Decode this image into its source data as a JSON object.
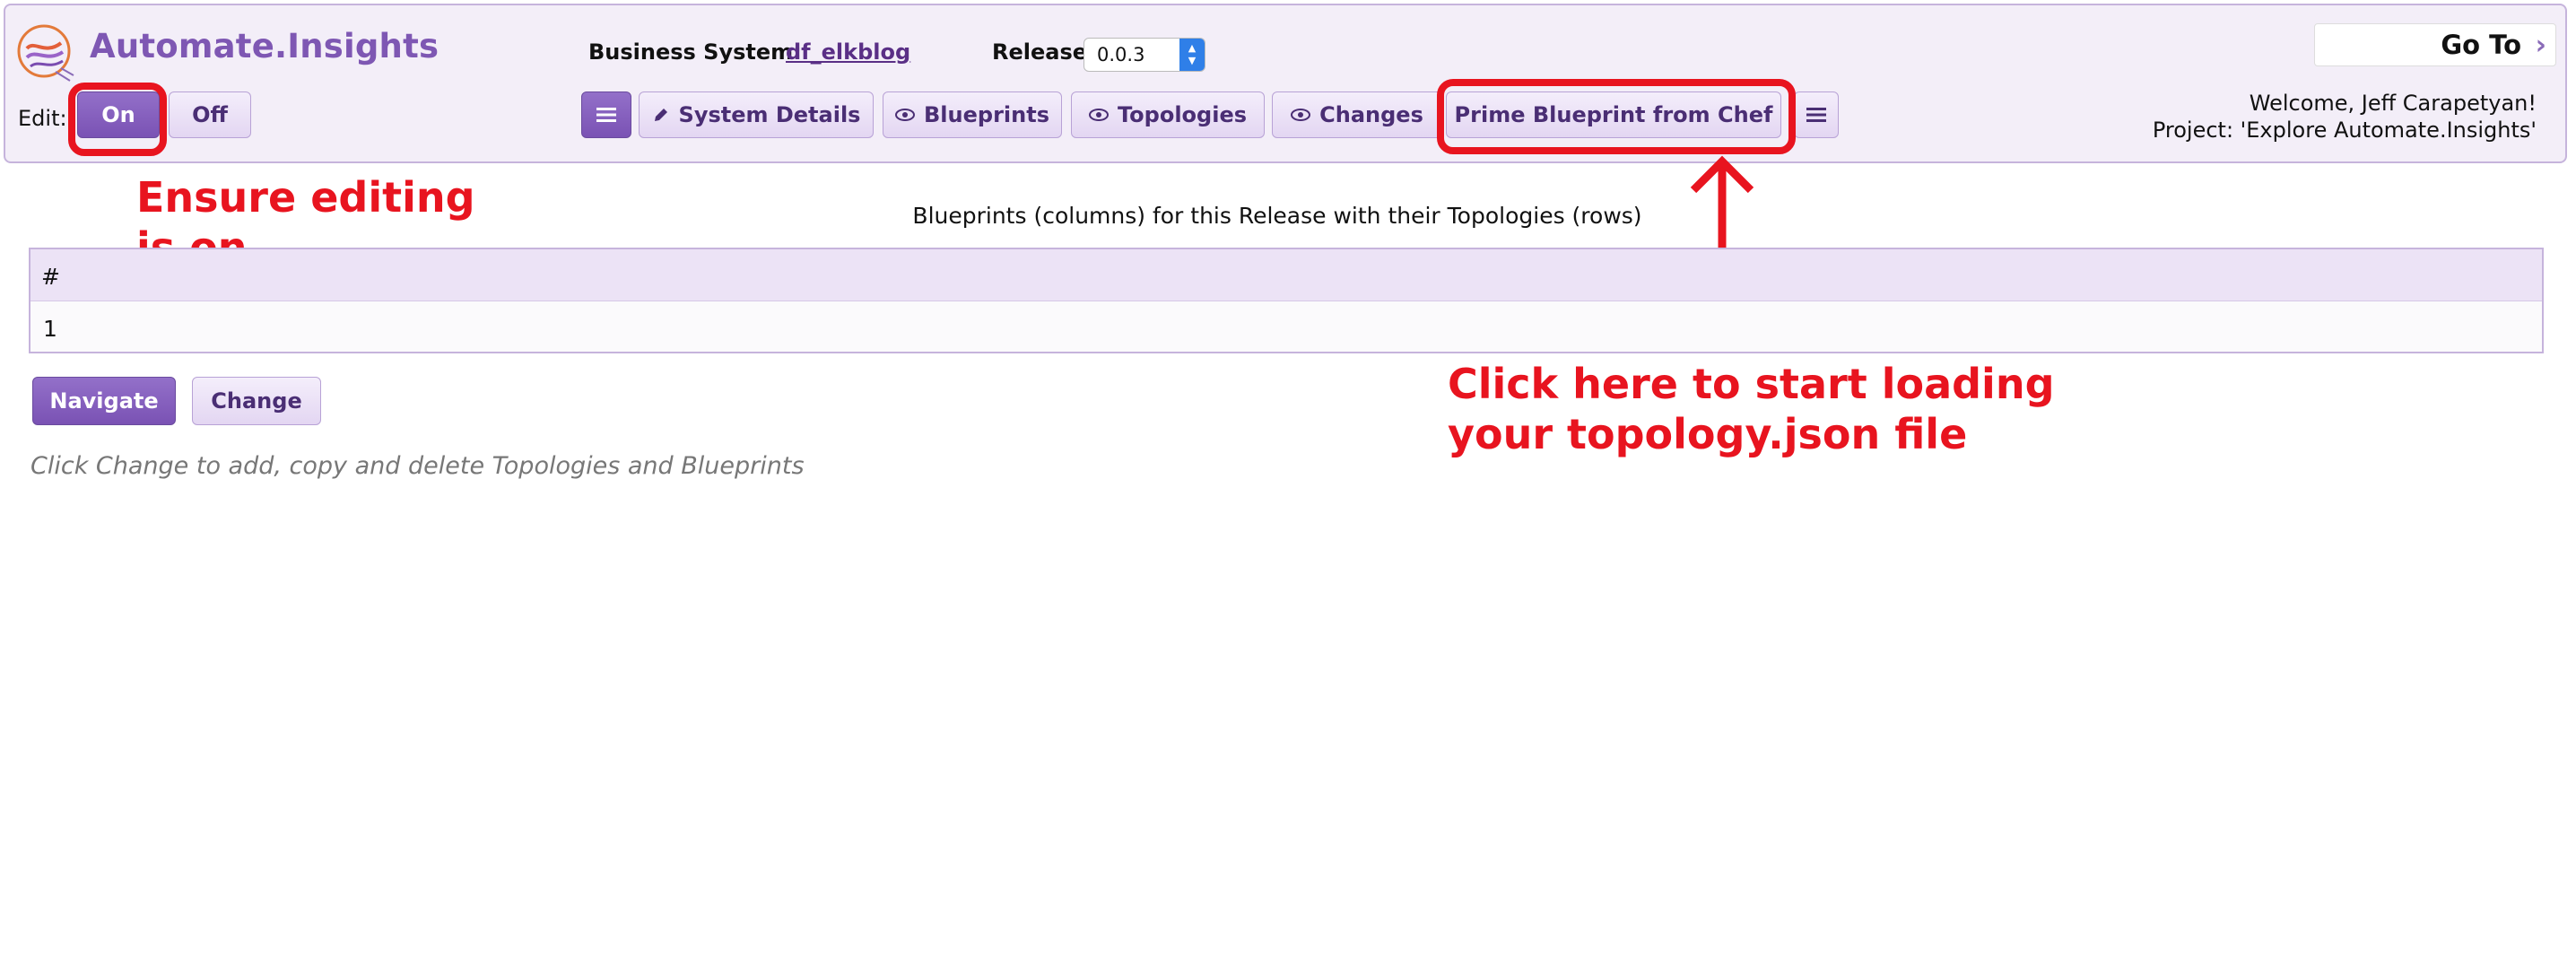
{
  "header": {
    "brand": "Automate.Insights",
    "business_system_label": "Business System:",
    "business_system_value": "df_elkblog",
    "release_label": "Release",
    "release_value": "0.0.3",
    "goto_label": "Go To",
    "welcome_line": "Welcome, Jeff Carapetyan!",
    "project_line": "Project: 'Explore Automate.Insights'"
  },
  "edit": {
    "label": "Edit:",
    "on_label": "On",
    "off_label": "Off"
  },
  "toolbar": {
    "system_details": "System Details",
    "blueprints": "Blueprints",
    "topologies": "Topologies",
    "changes": "Changes",
    "prime_blueprint": "Prime Blueprint from Chef"
  },
  "main": {
    "caption": "Blueprints (columns) for this Release with their Topologies (rows)",
    "table": {
      "header": "#",
      "rows": [
        "1"
      ]
    },
    "navigate_label": "Navigate",
    "change_label": "Change",
    "hint": "Click Change to add, copy and delete Topologies and Blueprints"
  },
  "annotations": {
    "edit_note": "Ensure editing is on",
    "prime_note": "Click here to start loading your topology.json file"
  },
  "colors": {
    "annotation_red": "#e8141f",
    "brand_purple": "#7e57b3",
    "header_bg": "#f3eef8"
  }
}
